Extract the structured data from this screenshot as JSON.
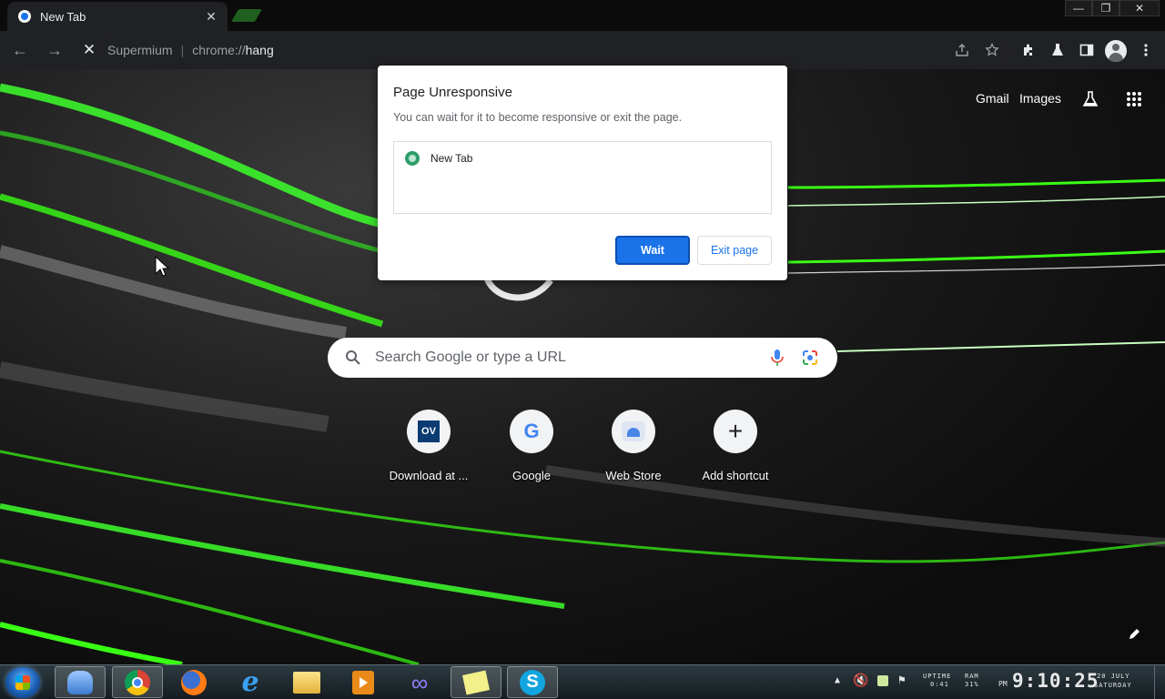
{
  "tab": {
    "title": "New Tab",
    "close_glyph": "✕"
  },
  "window_controls": {
    "minimize": "—",
    "restore": "❐",
    "close": "✕"
  },
  "toolbar": {
    "back": "←",
    "forward": "→",
    "stop": "✕",
    "omnibox": {
      "host": "Supermium",
      "separator": "|",
      "scheme": "chrome://",
      "path": "hang"
    }
  },
  "ntp": {
    "gmail": "Gmail",
    "images": "Images",
    "search_placeholder": "Search Google or type a URL",
    "shortcuts": [
      {
        "label": "Download at ...",
        "badge": "OV"
      },
      {
        "label": "Google",
        "badge": "G"
      },
      {
        "label": "Web Store",
        "badge": ""
      },
      {
        "label": "Add shortcut",
        "badge": "+"
      }
    ]
  },
  "dialog": {
    "title": "Page Unresponsive",
    "message": "You can wait for it to become responsive or exit the page.",
    "pages": [
      "New Tab"
    ],
    "wait": "Wait",
    "exit": "Exit page"
  },
  "taskbar": {
    "uptime_label": "UPTIME",
    "uptime_value": "0:41",
    "ram_label": "RAM",
    "ram_value": "31%",
    "ampm": "PM",
    "time": "9:10:25",
    "date": "20 JULY",
    "day": "SATURDAY"
  },
  "colors": {
    "accent": "#1a73e8",
    "wallpaper_green": "#39ff14",
    "toolbar": "#202124"
  }
}
